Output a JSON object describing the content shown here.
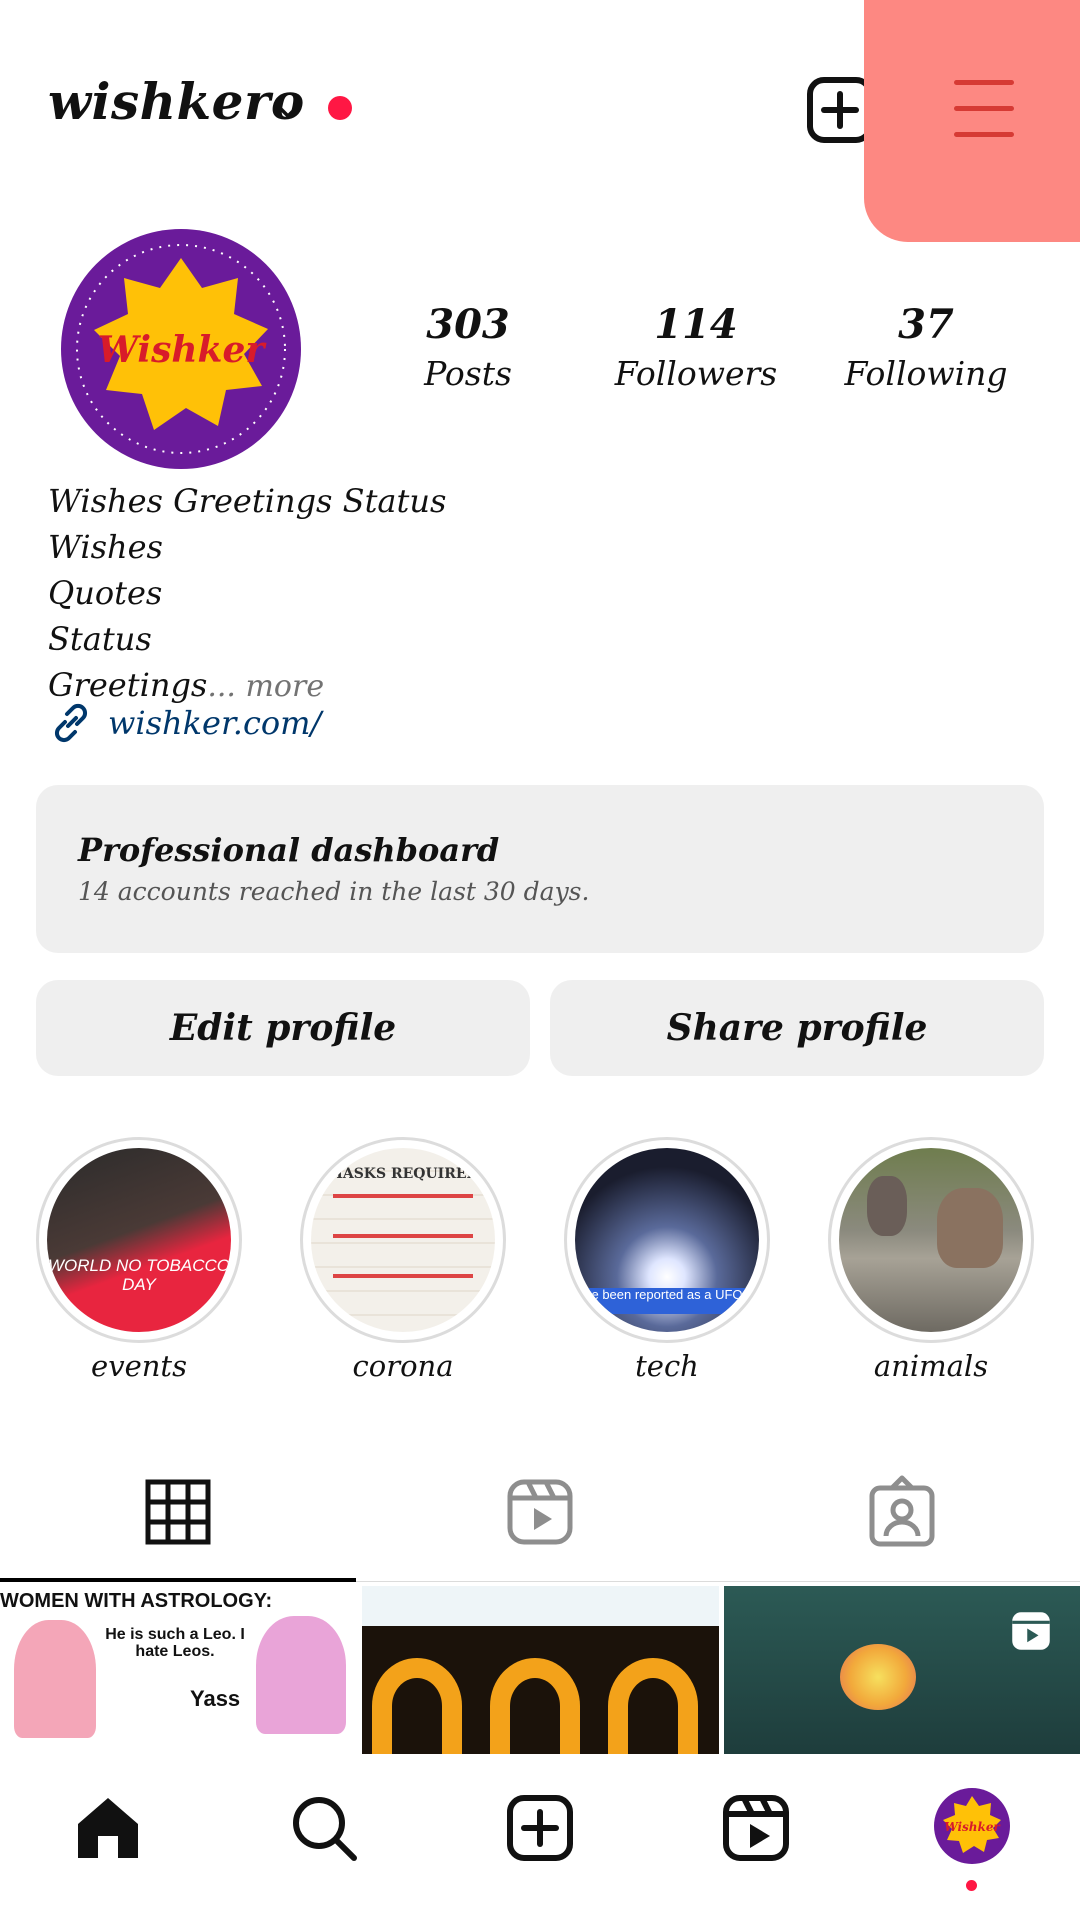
{
  "header": {
    "username": "wishkero",
    "new_post_icon": "plus-square-icon",
    "menu_icon": "hamburger-menu-icon"
  },
  "profile": {
    "avatar_text": "Wishker",
    "stats": [
      {
        "value": "303",
        "label": "Posts"
      },
      {
        "value": "114",
        "label": "Followers"
      },
      {
        "value": "37",
        "label": "Following"
      }
    ],
    "bio_lines": [
      "Wishes Greetings Status",
      "Wishes",
      "Quotes",
      "Status",
      "Greetings"
    ],
    "bio_more": "... more",
    "link": "wishker.com/"
  },
  "dashboard": {
    "title": "Professional dashboard",
    "subtitle": "14 accounts reached in the last 30 days."
  },
  "buttons": {
    "edit": "Edit profile",
    "share": "Share profile"
  },
  "highlights": [
    {
      "label": "events",
      "caption": "WORLD NO TOBACCO DAY"
    },
    {
      "label": "corona",
      "caption": "MASKS REQUIRED"
    },
    {
      "label": "tech",
      "caption": "e been reported as a UFO"
    },
    {
      "label": "animals",
      "caption": ""
    }
  ],
  "grid": {
    "post1_title": "WOMEN WITH ASTROLOGY:",
    "post1_bubble": "He is such a Leo. I hate Leos.",
    "post1_reply": "Yass"
  },
  "colors": {
    "accent_red": "#ff1744",
    "menu_highlight": "#fd8882",
    "link": "#00376b",
    "card_bg": "#efefef"
  }
}
